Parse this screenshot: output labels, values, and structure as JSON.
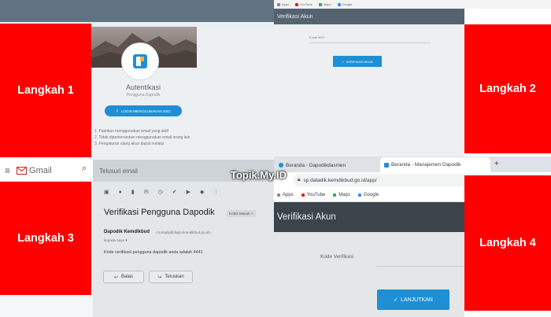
{
  "steps": [
    "Langkah 1",
    "Langkah 2",
    "Langkah 3",
    "Langkah 4"
  ],
  "watermark": "Topik.My.ID",
  "q1": {
    "title": "Autentikasi",
    "subtitle": "Pengguna Dapodik",
    "sso_button": "LOGIN MENGGUNAKAN SSO",
    "instructions": [
      "1. Pastikan menggunakan email yang aktif",
      "2. Tidak diperkenankan menggunakan email orang lain",
      "3. Pengaturan ulang akun dapat melalui"
    ]
  },
  "q2": {
    "bookmarks": [
      "Apps",
      "YouTube",
      "Maps",
      "Google"
    ],
    "header": "Verifikasi Akun",
    "field_label": "Email AKIP",
    "button": "VERIFIKASI AKUN"
  },
  "q3": {
    "app_name": "Gmail",
    "search_placeholder": "Telusuri email",
    "subject": "Verifikasi Pengguna Dapodik",
    "label_chip": "Kotak Masuk ×",
    "sender_name": "Dapodik Kemdikbud",
    "sender_email": "<noreply@dapo.kemdikbud.go.id>",
    "to": "kepada saya ▾",
    "body": "Kode verifikasi pengguna dapodik anda adalah 4441",
    "reply": "Balas",
    "forward": "Teruskan"
  },
  "q4": {
    "tab1": "Beranda - Dapodikdasmen",
    "tab2": "Beranda - Manajemen Dapodik",
    "new_tab": "+",
    "url": "sp.datadik.kemdikbud.go.id/app/",
    "bookmarks": [
      "Apps",
      "YouTube",
      "Maps",
      "Google"
    ],
    "header": "Verifikasi Akun",
    "field_label": "Kode Verifikasi",
    "button": "LANJUTKAN"
  },
  "colors": {
    "step_red": "#ff0000",
    "primary_blue": "#1e8fd5",
    "header_dark": "#3b444b"
  }
}
